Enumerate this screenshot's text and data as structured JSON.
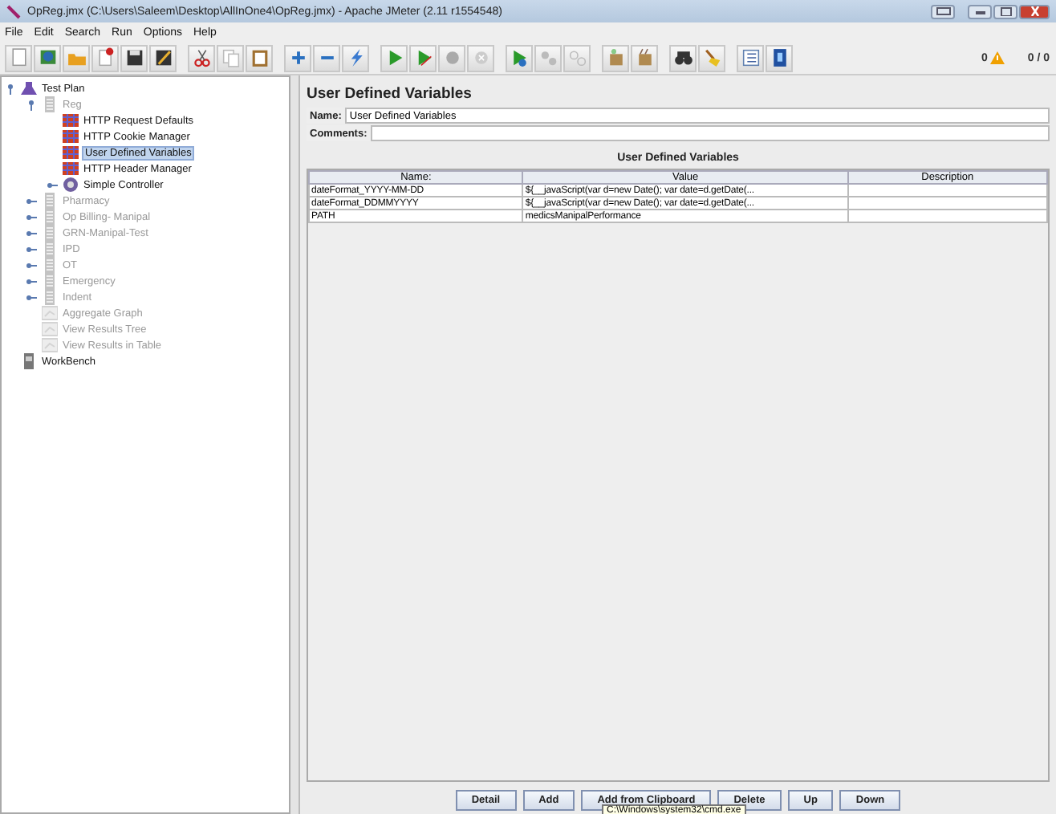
{
  "window": {
    "title": "OpReg.jmx (C:\\Users\\Saleem\\Desktop\\AllInOne4\\OpReg.jmx) - Apache JMeter (2.11 r1554548)"
  },
  "menu": [
    "File",
    "Edit",
    "Search",
    "Run",
    "Options",
    "Help"
  ],
  "status": {
    "warnings": "0",
    "threads": "0 / 0"
  },
  "tree": [
    {
      "label": "Test Plan",
      "kind": "plan",
      "disabled": false,
      "selected": false,
      "expanded": true,
      "children": [
        {
          "label": "Reg",
          "kind": "thread",
          "disabled": true,
          "selected": false,
          "expanded": true,
          "children": [
            {
              "label": "HTTP Request Defaults",
              "kind": "config",
              "disabled": false,
              "selected": false
            },
            {
              "label": "HTTP Cookie Manager",
              "kind": "config",
              "disabled": false,
              "selected": false
            },
            {
              "label": "User Defined Variables",
              "kind": "config",
              "disabled": false,
              "selected": true
            },
            {
              "label": "HTTP Header Manager",
              "kind": "config",
              "disabled": false,
              "selected": false
            },
            {
              "label": "Simple Controller",
              "kind": "controller",
              "disabled": false,
              "selected": false,
              "expanded": false
            }
          ]
        },
        {
          "label": "Pharmacy",
          "kind": "thread",
          "disabled": true,
          "selected": false,
          "expanded": false
        },
        {
          "label": "Op Billing- Manipal",
          "kind": "thread",
          "disabled": true,
          "selected": false,
          "expanded": false
        },
        {
          "label": "GRN-Manipal-Test",
          "kind": "thread",
          "disabled": true,
          "selected": false,
          "expanded": false
        },
        {
          "label": "IPD",
          "kind": "thread",
          "disabled": true,
          "selected": false,
          "expanded": false
        },
        {
          "label": "OT",
          "kind": "thread",
          "disabled": true,
          "selected": false,
          "expanded": false
        },
        {
          "label": "Emergency",
          "kind": "thread",
          "disabled": true,
          "selected": false,
          "expanded": false
        },
        {
          "label": "Indent",
          "kind": "thread",
          "disabled": true,
          "selected": false,
          "expanded": false
        },
        {
          "label": "Aggregate Graph",
          "kind": "listener",
          "disabled": true,
          "selected": false
        },
        {
          "label": "View Results Tree",
          "kind": "listener",
          "disabled": true,
          "selected": false
        },
        {
          "label": "View Results in Table",
          "kind": "listener",
          "disabled": true,
          "selected": false
        }
      ]
    },
    {
      "label": "WorkBench",
      "kind": "workbench",
      "disabled": false,
      "selected": false
    }
  ],
  "panel": {
    "title": "User Defined Variables",
    "name_label": "Name:",
    "name_value": "User Defined Variables",
    "comments_label": "Comments:",
    "table": {
      "title": "User Defined Variables",
      "columns": [
        "Name:",
        "Value",
        "Description"
      ],
      "rows": [
        [
          "dateFormat_YYYY-MM-DD",
          "${__javaScript(var d=new Date(); var date=d.getDate(...",
          ""
        ],
        [
          "dateFormat_DDMMYYYY",
          "${__javaScript(var d=new Date(); var date=d.getDate(...",
          ""
        ],
        [
          "PATH",
          "medicsManipalPerformance",
          ""
        ]
      ]
    },
    "buttons": [
      "Detail",
      "Add",
      "Add from Clipboard",
      "Delete",
      "Up",
      "Down"
    ],
    "tooltip": "C:\\Windows\\system32\\cmd.exe"
  }
}
